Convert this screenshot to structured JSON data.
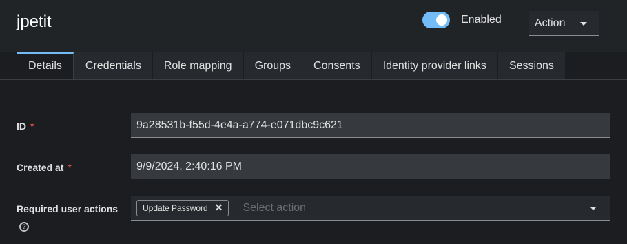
{
  "header": {
    "title": "jpetit",
    "enabled_label": "Enabled",
    "enabled_state": true,
    "action_label": "Action"
  },
  "tabs": [
    {
      "label": "Details",
      "active": true
    },
    {
      "label": "Credentials"
    },
    {
      "label": "Role mapping"
    },
    {
      "label": "Groups"
    },
    {
      "label": "Consents"
    },
    {
      "label": "Identity provider links"
    },
    {
      "label": "Sessions"
    }
  ],
  "form": {
    "id": {
      "label": "ID",
      "required_mark": "*",
      "value": "9a28531b-f55d-4e4a-a774-e071dbc9c621"
    },
    "created_at": {
      "label": "Created at",
      "required_mark": "*",
      "value": "9/9/2024, 2:40:16 PM"
    },
    "required_actions": {
      "label": "Required user actions",
      "chips": [
        "Update Password"
      ],
      "chip_close": "✕",
      "placeholder": "Select action",
      "help_icon": "?"
    }
  },
  "colors": {
    "accent": "#73bcf7",
    "required": "#f0564e",
    "background": "#1b1d21"
  }
}
